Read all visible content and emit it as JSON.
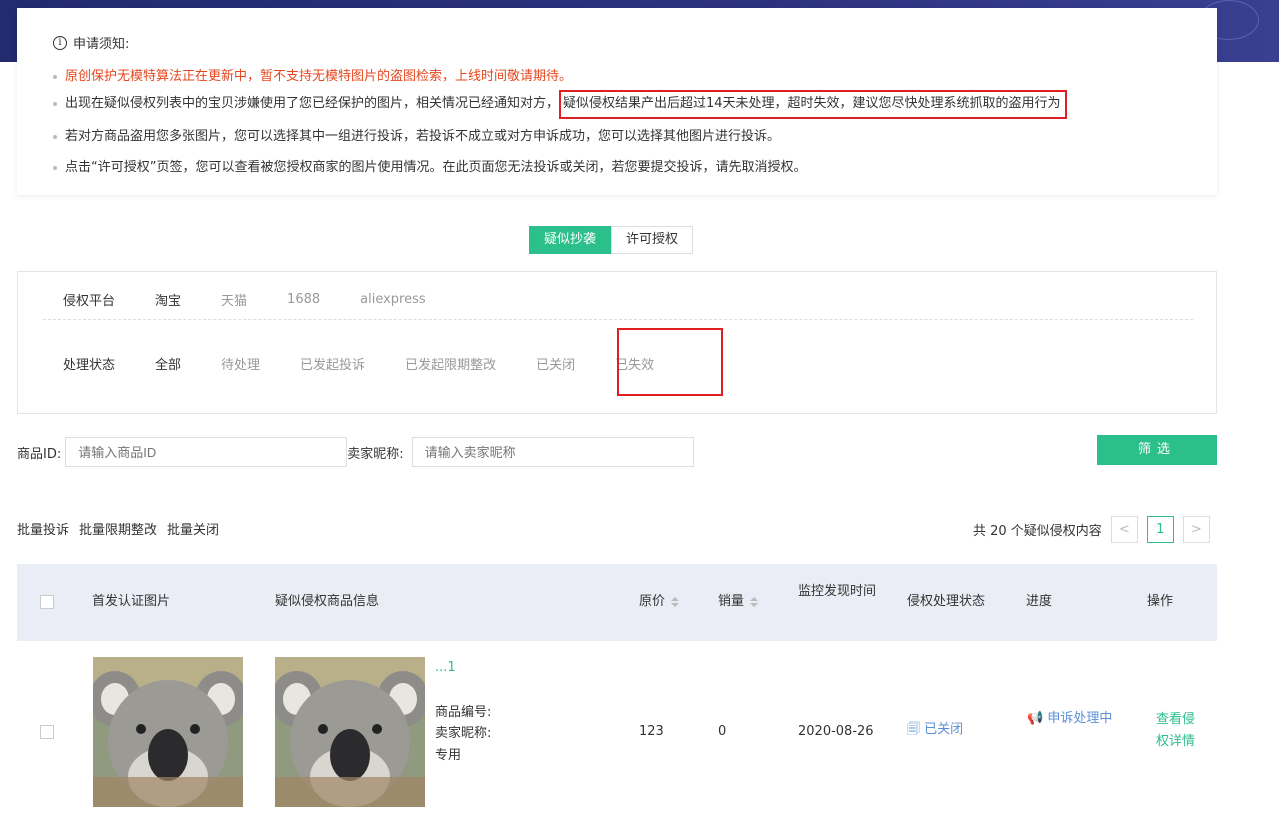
{
  "notice": {
    "title": "申请须知:",
    "lines": [
      "原创保护无模特算法正在更新中，暂不支持无模特图片的盗图检索，上线时间敬请期待。",
      "出现在疑似侵权列表中的宝贝涉嫌使用了您已经保护的图片，相关情况已经通知对方，",
      "疑似侵权结果产出后超过14天未处理，超时失效，建议您尽快处理系统抓取的盗用行为",
      "若对方商品盗用您多张图片，您可以选择其中一组进行投诉，若投诉不成立或对方申诉成功，您可以选择其他图片进行投诉。",
      "点击“许可授权”页签，您可以查看被您授权商家的图片使用情况。在此页面您无法投诉或关闭，若您要提交投诉，请先取消授权。"
    ],
    "warning_color": "#e6471f"
  },
  "tabs": [
    "疑似抄袭",
    "许可授权"
  ],
  "filters": {
    "platform_label": "侵权平台",
    "platforms": [
      "淘宝",
      "天猫",
      "1688",
      "aliexpress"
    ],
    "status_label": "处理状态",
    "statuses": [
      "全部",
      "待处理",
      "已发起投诉",
      "已发起限期整改",
      "已关闭",
      "已失效"
    ]
  },
  "search": {
    "product_id_label": "商品ID:",
    "product_id_placeholder": "请输入商品ID",
    "seller_label": "卖家昵称:",
    "seller_placeholder": "请输入卖家昵称",
    "filter_button": "筛选"
  },
  "bulk": [
    "批量投诉",
    "批量限期整改",
    "批量关闭"
  ],
  "pager": {
    "summary": "共 20 个疑似侵权内容",
    "prev": "<",
    "current": "1",
    "next": ">"
  },
  "table": {
    "headers": [
      "首发认证图片",
      "疑似侵权商品信息",
      "原价",
      "销量",
      "监控发现时间",
      "侵权处理状态",
      "进度",
      "操作"
    ],
    "row": {
      "title_partial": "...1",
      "product_no_label": "商品编号:",
      "seller_label": "卖家昵称:",
      "seller_suffix": "专用",
      "price": "123",
      "sales": "0",
      "date": "2020-08-26",
      "status": "已关闭",
      "progress": "申诉处理中",
      "action": "查看侵权详情"
    }
  },
  "accent_color": "#2bbf8b"
}
